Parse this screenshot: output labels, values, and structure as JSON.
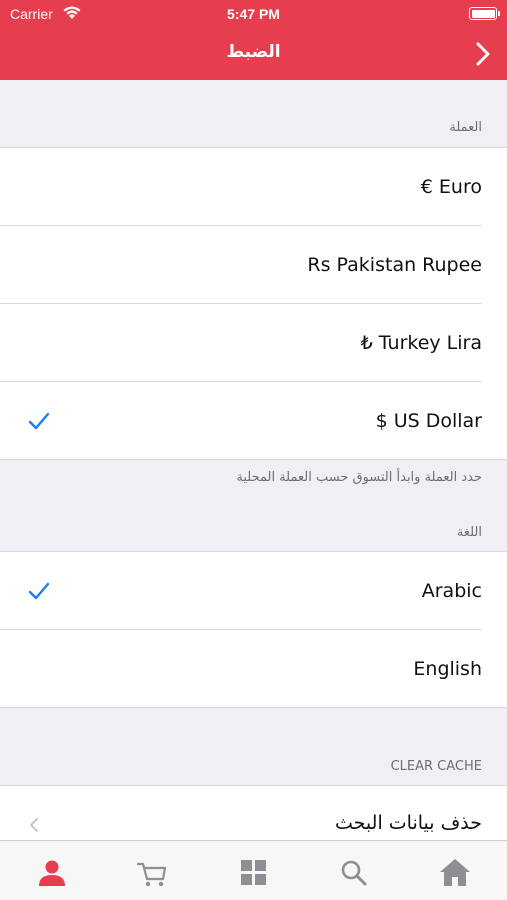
{
  "status_bar": {
    "carrier": "Carrier",
    "time": "5:47 PM"
  },
  "header": {
    "title": "الضبط"
  },
  "currency_section": {
    "header": "العملة",
    "items": [
      {
        "label": "€ Euro",
        "selected": false
      },
      {
        "label": "Rs Pakistan Rupee",
        "selected": false
      },
      {
        "label": "₺ Turkey Lira",
        "selected": false
      },
      {
        "label": "$ US Dollar",
        "selected": true
      }
    ],
    "footer": "حدد العملة وابدأ التسوق حسب العملة المحلية"
  },
  "language_section": {
    "header": "اللغة",
    "items": [
      {
        "label": "Arabic",
        "selected": true
      },
      {
        "label": "English",
        "selected": false
      }
    ]
  },
  "cache_section": {
    "header": "CLEAR CACHE",
    "items": [
      {
        "label": "حذف بيانات البحث"
      }
    ]
  },
  "tab_bar": {
    "tabs": [
      {
        "icon": "person-icon",
        "active": true
      },
      {
        "icon": "cart-icon",
        "active": false
      },
      {
        "icon": "grid-icon",
        "active": false
      },
      {
        "icon": "search-icon",
        "active": false
      },
      {
        "icon": "home-icon",
        "active": false
      }
    ]
  },
  "colors": {
    "accent": "#e63d4f",
    "check": "#1d7cf2",
    "tab_active": "#e63d4f",
    "tab_inactive": "#8e8e93"
  }
}
